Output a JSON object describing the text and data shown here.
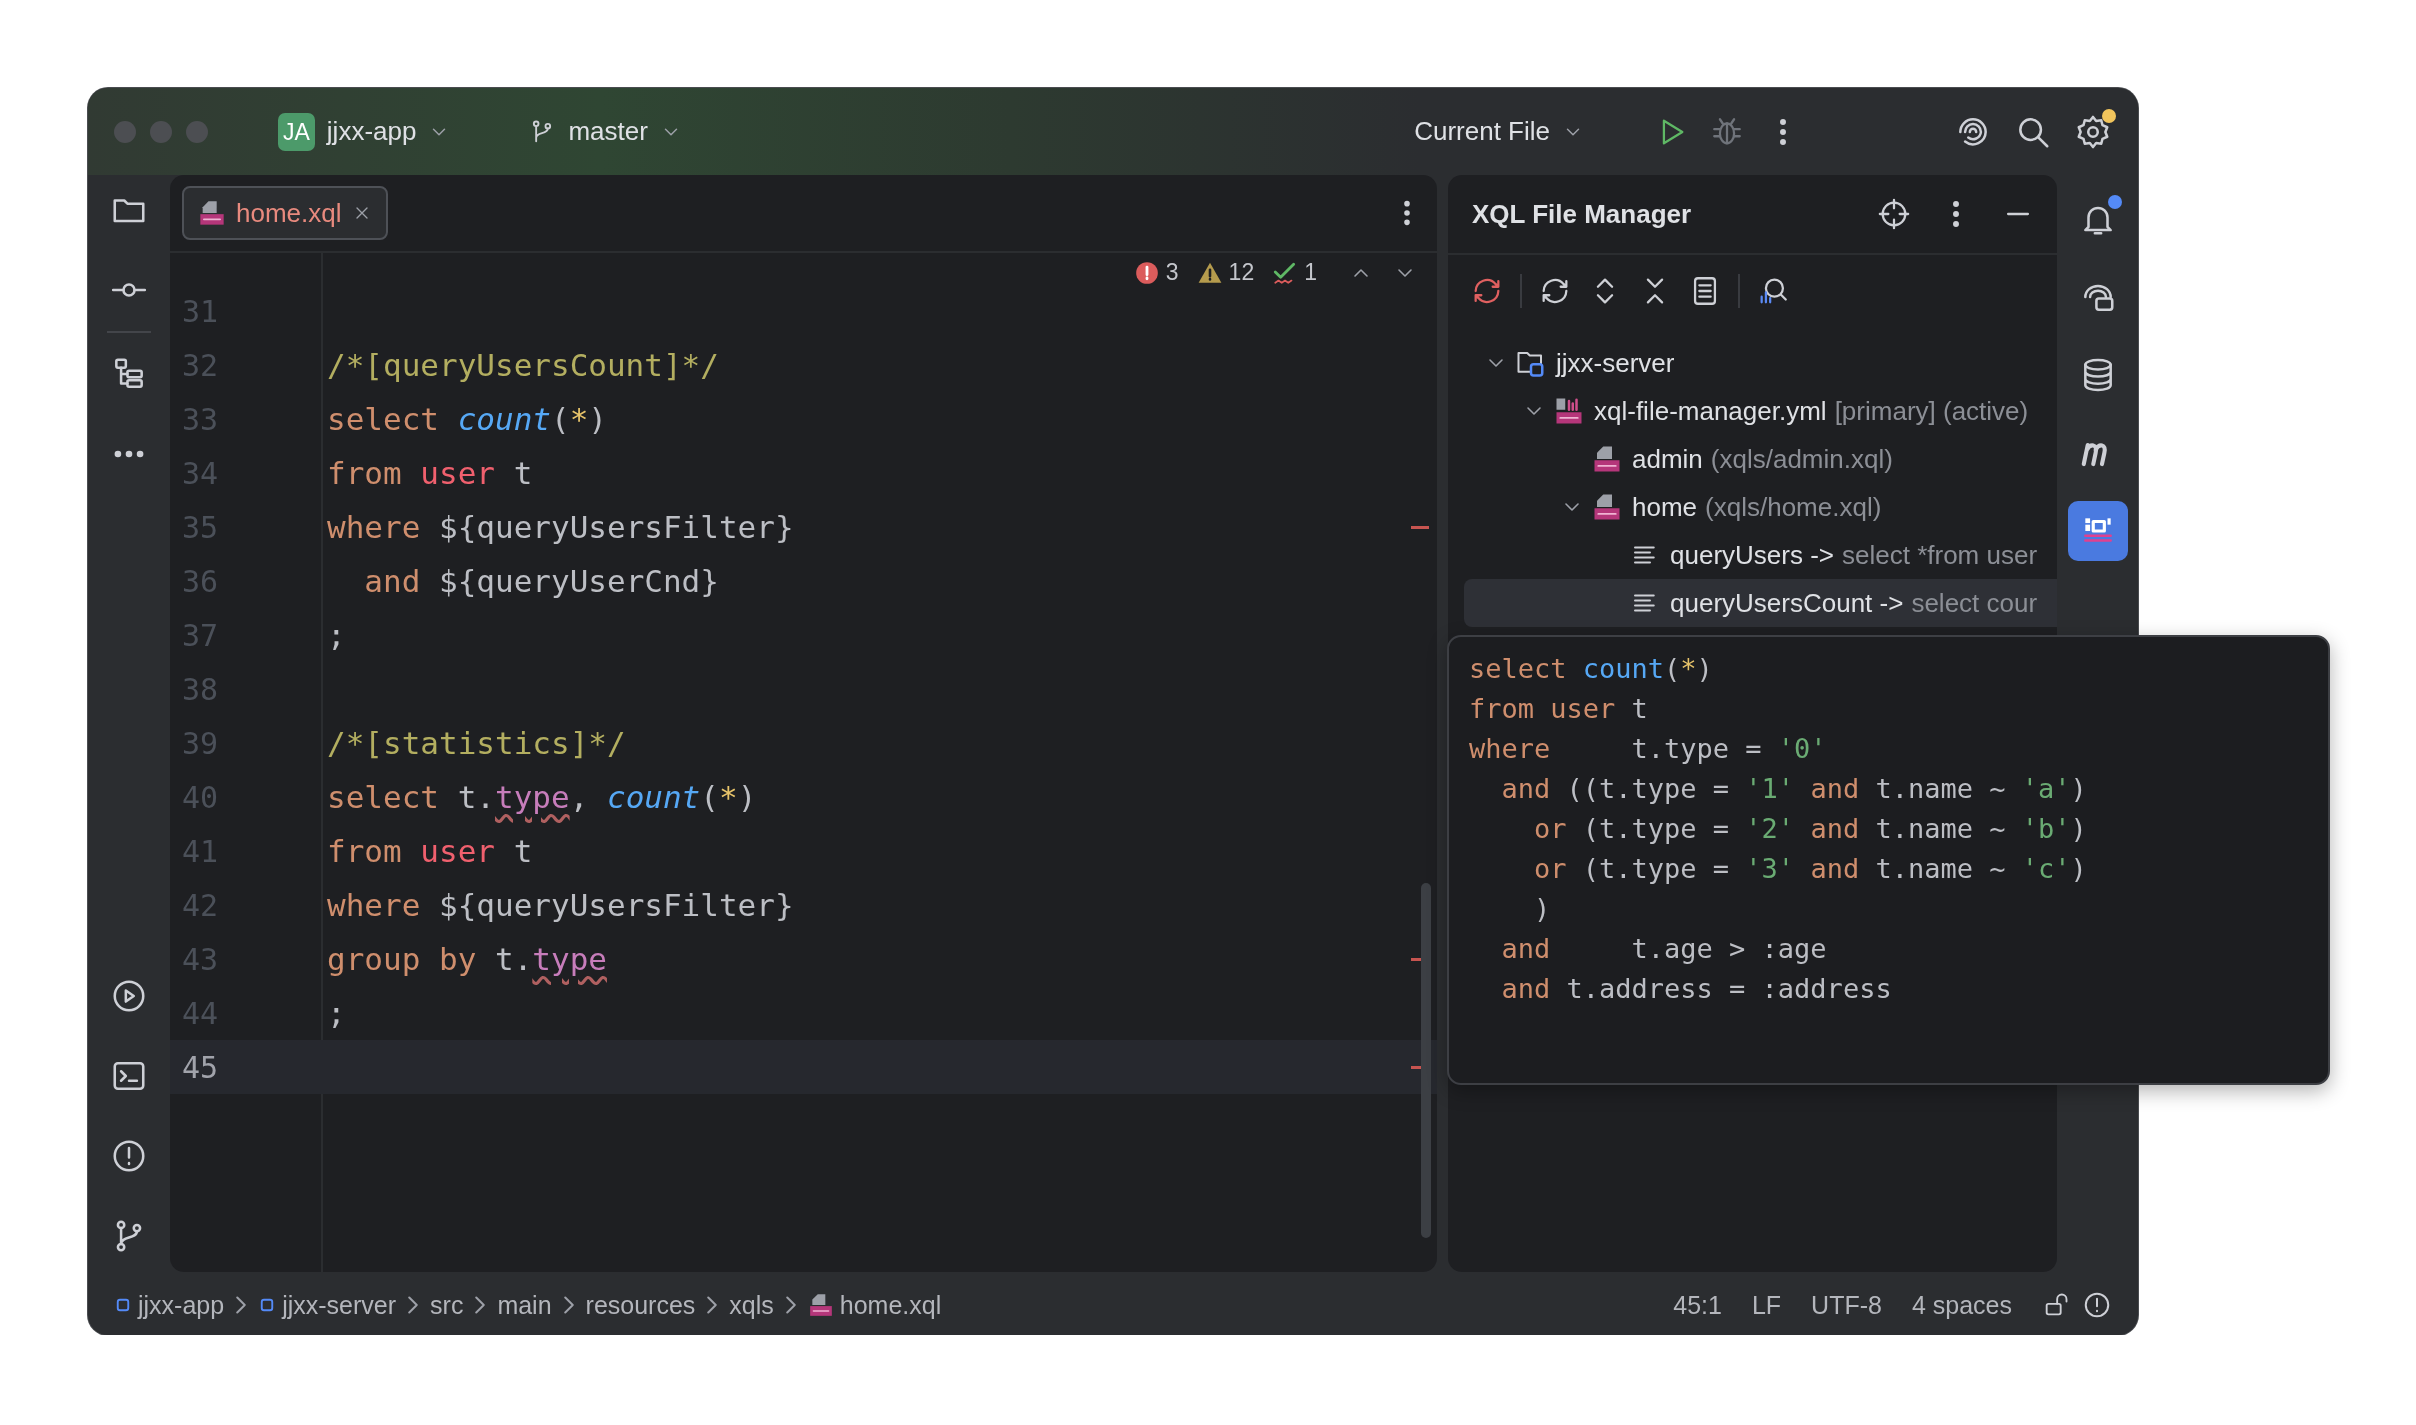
{
  "title_bar": {
    "project": {
      "initials": "JA",
      "name": "jjxx-app"
    },
    "branch": "master",
    "run_config": "Current File",
    "settings_badge": true
  },
  "editor": {
    "tabs": [
      {
        "label": "home.xql",
        "selected": true,
        "has_errors": true
      }
    ],
    "problems": {
      "errors": "3",
      "warnings": "12",
      "typos": "1"
    },
    "lines": [
      {
        "number": "31",
        "current": false,
        "flagged": false
      },
      {
        "number": "32",
        "current": false,
        "flagged": false,
        "tokens": [
          {
            "kind": "comment",
            "text": "/*[queryUsersCount]*/"
          }
        ]
      },
      {
        "number": "33",
        "current": false,
        "flagged": false,
        "tokens": [
          {
            "kind": "keyword",
            "text": "select "
          },
          {
            "kind": "function",
            "text": "count"
          },
          {
            "kind": "plain",
            "text": "("
          },
          {
            "kind": "star",
            "text": "*"
          },
          {
            "kind": "plain",
            "text": ")"
          }
        ]
      },
      {
        "number": "34",
        "current": false,
        "flagged": false,
        "tokens": [
          {
            "kind": "keyword",
            "text": "from "
          },
          {
            "kind": "table",
            "text": "user"
          },
          {
            "kind": "plain",
            "text": " t"
          }
        ]
      },
      {
        "number": "35",
        "current": false,
        "flagged": true,
        "tokens": [
          {
            "kind": "keyword",
            "text": "where"
          },
          {
            "kind": "plain",
            "text": " ${queryUsersFilter}"
          }
        ]
      },
      {
        "number": "36",
        "current": false,
        "flagged": false,
        "tokens": [
          {
            "kind": "keyword",
            "text": "  and"
          },
          {
            "kind": "plain",
            "text": " ${queryUserCnd}"
          }
        ]
      },
      {
        "number": "37",
        "current": false,
        "flagged": false,
        "tokens": [
          {
            "kind": "plain",
            "text": ";"
          }
        ]
      },
      {
        "number": "38",
        "current": false,
        "flagged": false
      },
      {
        "number": "39",
        "current": false,
        "flagged": false,
        "tokens": [
          {
            "kind": "comment",
            "text": "/*[statistics]*/"
          }
        ]
      },
      {
        "number": "40",
        "current": false,
        "flagged": false,
        "tokens": [
          {
            "kind": "keyword",
            "text": "select"
          },
          {
            "kind": "plain",
            "text": " t."
          },
          {
            "kind": "field",
            "text": "type"
          },
          {
            "kind": "plain",
            "text": ", "
          },
          {
            "kind": "function",
            "text": "count"
          },
          {
            "kind": "plain",
            "text": "("
          },
          {
            "kind": "star",
            "text": "*"
          },
          {
            "kind": "plain",
            "text": ")"
          }
        ]
      },
      {
        "number": "41",
        "current": false,
        "flagged": false,
        "tokens": [
          {
            "kind": "keyword",
            "text": "from "
          },
          {
            "kind": "table",
            "text": "user"
          },
          {
            "kind": "plain",
            "text": " t"
          }
        ]
      },
      {
        "number": "42",
        "current": false,
        "flagged": false,
        "tokens": [
          {
            "kind": "keyword",
            "text": "where"
          },
          {
            "kind": "plain",
            "text": " ${queryUsersFilter}"
          }
        ]
      },
      {
        "number": "43",
        "current": false,
        "flagged": true,
        "tokens": [
          {
            "kind": "keyword",
            "text": "group by"
          },
          {
            "kind": "plain",
            "text": " t."
          },
          {
            "kind": "field",
            "text": "type"
          }
        ]
      },
      {
        "number": "44",
        "current": false,
        "flagged": false,
        "tokens": [
          {
            "kind": "plain",
            "text": ";"
          }
        ]
      },
      {
        "number": "45",
        "current": true,
        "flagged": true
      }
    ]
  },
  "xql_panel": {
    "title": "XQL File Manager",
    "tree": [
      {
        "kind": "module",
        "label": "jjxx-server",
        "expanded": true,
        "selected": false,
        "children": [
          {
            "kind": "config",
            "label": "xql-file-manager.yml",
            "detail": "[primary] (active)",
            "expanded": true,
            "selected": false,
            "children": [
              {
                "kind": "xql",
                "label": "admin",
                "detail": "(xqls/admin.xql)",
                "selected": false
              },
              {
                "kind": "xql",
                "label": "home",
                "detail": "(xqls/home.xql)",
                "expanded": true,
                "selected": false,
                "children": [
                  {
                    "kind": "query",
                    "label": "queryUsers ->",
                    "detail": "select *from user",
                    "selected": false
                  },
                  {
                    "kind": "query",
                    "label": "queryUsersCount ->",
                    "detail": "select cour",
                    "selected": true
                  }
                ]
              }
            ]
          }
        ]
      }
    ]
  },
  "tooltip": {
    "lines": [
      [
        {
          "kind": "keyword",
          "text": "select "
        },
        {
          "kind": "call",
          "text": "count"
        },
        {
          "kind": "plain",
          "text": "("
        },
        {
          "kind": "star",
          "text": "*"
        },
        {
          "kind": "plain",
          "text": ")"
        }
      ],
      [
        {
          "kind": "keyword",
          "text": "from user"
        },
        {
          "kind": "plain",
          "text": " t"
        }
      ],
      [
        {
          "kind": "keyword",
          "text": "where"
        },
        {
          "kind": "plain",
          "text": "     t.type = "
        },
        {
          "kind": "string",
          "text": "'0'"
        }
      ],
      [
        {
          "kind": "keyword",
          "text": "  and"
        },
        {
          "kind": "plain",
          "text": " ((t.type = "
        },
        {
          "kind": "string",
          "text": "'1' "
        },
        {
          "kind": "keyword",
          "text": "and"
        },
        {
          "kind": "plain",
          "text": " t.name ~ "
        },
        {
          "kind": "string",
          "text": "'a'"
        },
        {
          "kind": "plain",
          "text": ")"
        }
      ],
      [
        {
          "kind": "keyword",
          "text": "    or"
        },
        {
          "kind": "plain",
          "text": " (t.type = "
        },
        {
          "kind": "string",
          "text": "'2' "
        },
        {
          "kind": "keyword",
          "text": "and"
        },
        {
          "kind": "plain",
          "text": " t.name ~ "
        },
        {
          "kind": "string",
          "text": "'b'"
        },
        {
          "kind": "plain",
          "text": ")"
        }
      ],
      [
        {
          "kind": "keyword",
          "text": "    or"
        },
        {
          "kind": "plain",
          "text": " (t.type = "
        },
        {
          "kind": "string",
          "text": "'3' "
        },
        {
          "kind": "keyword",
          "text": "and"
        },
        {
          "kind": "plain",
          "text": " t.name ~ "
        },
        {
          "kind": "string",
          "text": "'c'"
        },
        {
          "kind": "plain",
          "text": ")"
        }
      ],
      [
        {
          "kind": "plain",
          "text": "    )"
        }
      ],
      [
        {
          "kind": "keyword",
          "text": "  and"
        },
        {
          "kind": "plain",
          "text": "     t.age > :age"
        }
      ],
      [
        {
          "kind": "keyword",
          "text": "  and"
        },
        {
          "kind": "plain",
          "text": " t.address = :address"
        }
      ]
    ]
  },
  "right_strip": [
    {
      "selected": false,
      "badge": true
    },
    {
      "selected": false,
      "badge": false
    },
    {
      "selected": false,
      "badge": false
    },
    {
      "selected": false,
      "badge": false
    },
    {
      "selected": true,
      "badge": false
    }
  ],
  "status_bar": {
    "breadcrumbs": [
      {
        "kind": "module",
        "label": "jjxx-app"
      },
      {
        "kind": "module",
        "label": "jjxx-server"
      },
      {
        "kind": "folder",
        "label": "src"
      },
      {
        "kind": "folder",
        "label": "main"
      },
      {
        "kind": "folder",
        "label": "resources"
      },
      {
        "kind": "folder",
        "label": "xqls"
      },
      {
        "kind": "xql",
        "label": "home.xql"
      }
    ],
    "position": "45:1",
    "line_separator": "LF",
    "encoding": "UTF-8",
    "indent": "4 spaces"
  }
}
